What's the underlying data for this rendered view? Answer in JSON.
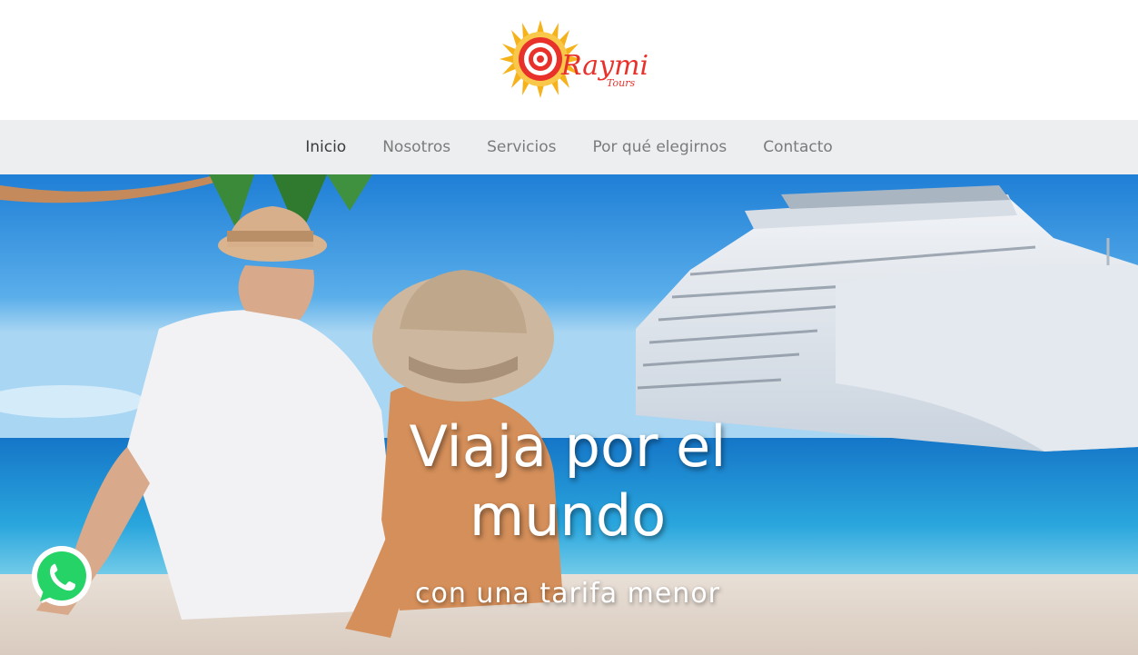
{
  "brand": {
    "logo_name": "Raymi",
    "logo_tagline": "Tours"
  },
  "nav": {
    "items": [
      {
        "label": "Inicio",
        "active": true
      },
      {
        "label": "Nosotros",
        "active": false
      },
      {
        "label": "Servicios",
        "active": false
      },
      {
        "label": "Por qué elegirnos",
        "active": false
      },
      {
        "label": "Contacto",
        "active": false
      }
    ]
  },
  "hero": {
    "title": "Viaja por el mundo",
    "subtitle": "con una tarifa menor"
  },
  "floating": {
    "icon": "whatsapp-icon"
  },
  "colors": {
    "nav_bg": "#eceef0",
    "nav_text": "#7b7b7b",
    "nav_active": "#3b3b3b",
    "logo_red": "#e8312b",
    "logo_yellow": "#f6b21a",
    "whatsapp_green": "#25d366"
  }
}
